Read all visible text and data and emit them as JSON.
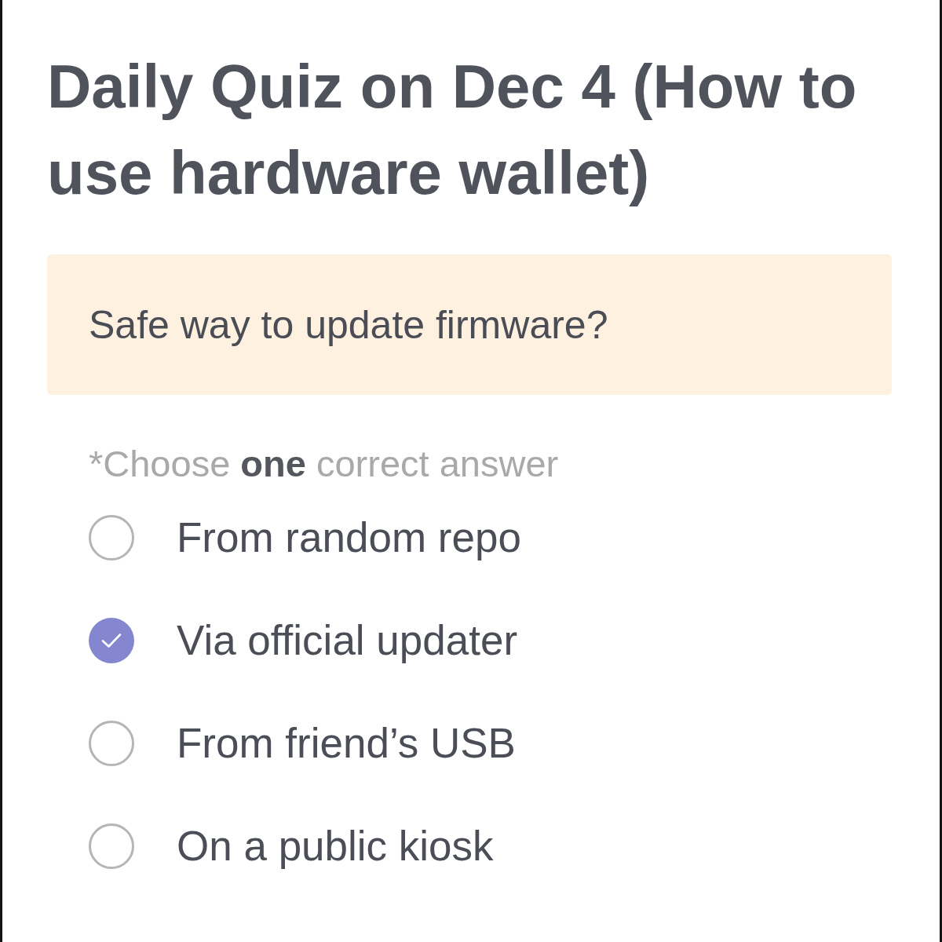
{
  "title": "Daily Quiz on Dec 4 (How to use hardware wallet)",
  "question": "Safe way to update firmware?",
  "instruction": "*Choose **one** correct answer",
  "options": [
    {
      "label": "From random repo",
      "selected": false
    },
    {
      "label": "Via official updater",
      "selected": true
    },
    {
      "label": "From friend’s USB",
      "selected": false
    },
    {
      "label": "On a public kiosk",
      "selected": false
    }
  ]
}
